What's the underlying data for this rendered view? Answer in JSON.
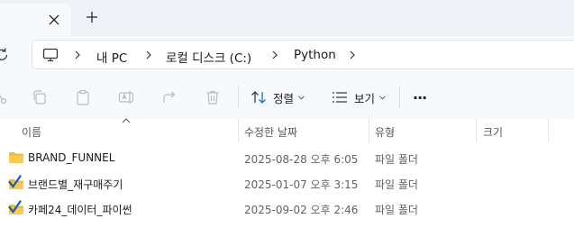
{
  "tabbar": {
    "close_icon": "close-icon",
    "new_tab_icon": "plus-icon"
  },
  "address": {
    "crumbs": [
      "내 PC",
      "로컬 디스크 (C:)",
      "Python"
    ]
  },
  "toolbar": {
    "sort_label": "정렬",
    "view_label": "보기",
    "more_label": "···"
  },
  "columns": {
    "name": "이름",
    "modified": "수정한 날짜",
    "type": "유형",
    "size": "크기"
  },
  "files": [
    {
      "name": "BRAND_FUNNEL",
      "modified": "2025-08-28 오후 6:05",
      "type": "파일 폴더",
      "icon": "folder-icon"
    },
    {
      "name": "브랜드별_재구매주기",
      "modified": "2025-01-07 오후 3:15",
      "type": "파일 폴더",
      "icon": "checked-folder-icon"
    },
    {
      "name": "카페24_데이터_파이썬",
      "modified": "2025-09-02 오후 2:46",
      "type": "파일 폴더",
      "icon": "checked-folder-icon"
    }
  ],
  "colors": {
    "accent": "#1a73c9",
    "folder": "#f5c04a"
  }
}
